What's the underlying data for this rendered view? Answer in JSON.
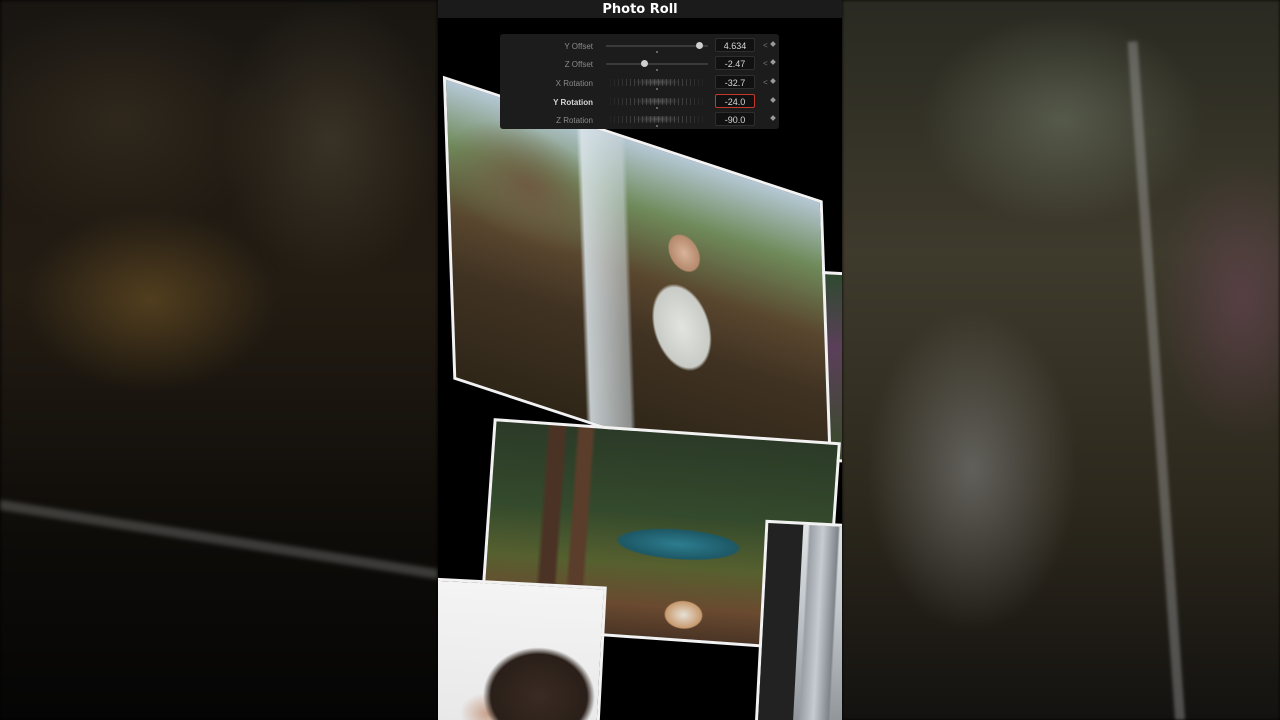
{
  "window": {
    "title": "Photo Roll"
  },
  "inspector": {
    "params": [
      {
        "label": "Y Offset",
        "value": "4.634",
        "control": "slider",
        "level": 0.92,
        "has_arrow": true,
        "active": false
      },
      {
        "label": "Z Offset",
        "value": "-2.47",
        "control": "slider",
        "level": 0.38,
        "has_arrow": true,
        "active": false
      },
      {
        "label": "X Rotation",
        "value": "-32.7",
        "control": "jog",
        "has_arrow": true,
        "active": false
      },
      {
        "label": "Y Rotation",
        "value": "-24.0",
        "control": "jog",
        "has_arrow": false,
        "active": true
      },
      {
        "label": "Z Rotation",
        "value": "-90.0",
        "control": "jog",
        "has_arrow": false,
        "active": false
      }
    ],
    "icons": {
      "prev_keyframe": "chevron-left-icon",
      "keyframe": "diamond-icon"
    },
    "colors": {
      "active_border": "#c0392b",
      "panel_bg": "#1c1c1c"
    }
  },
  "photos": [
    "waterfall-portrait",
    "hammock-with-dog",
    "city-building",
    "woman-portrait",
    "purple-flowers"
  ]
}
